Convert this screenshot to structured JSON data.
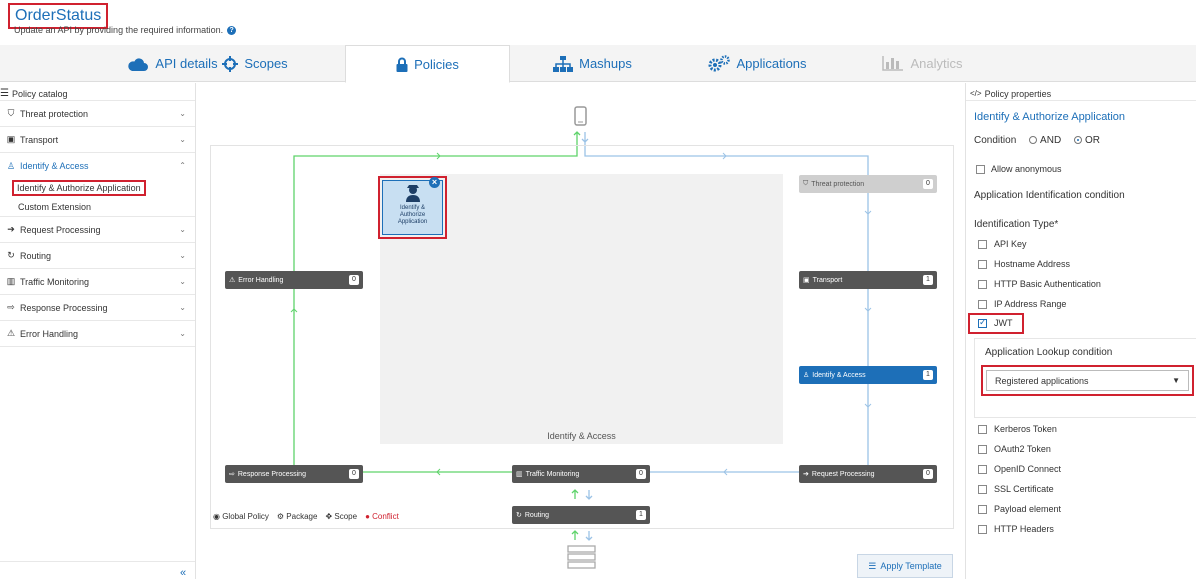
{
  "header": {
    "title": "OrderStatus",
    "subtitle": "Update an API by providing the required information."
  },
  "tabs": [
    {
      "label": "API details",
      "icon": "cloud-icon"
    },
    {
      "label": "Scopes",
      "icon": "crosshair-icon"
    },
    {
      "label": "Policies",
      "icon": "lock-icon"
    },
    {
      "label": "Mashups",
      "icon": "sitemap-icon"
    },
    {
      "label": "Applications",
      "icon": "gears-icon"
    },
    {
      "label": "Analytics",
      "icon": "bar-chart-icon"
    }
  ],
  "catalog": {
    "title": "Policy catalog",
    "items": [
      {
        "label": "Threat protection",
        "icon": "shield-icon"
      },
      {
        "label": "Transport",
        "icon": "bus-icon"
      },
      {
        "label": "Identify & Access",
        "icon": "user-lock-icon"
      },
      {
        "label": "Request Processing",
        "icon": "sign-in-icon"
      },
      {
        "label": "Routing",
        "icon": "refresh-icon"
      },
      {
        "label": "Traffic Monitoring",
        "icon": "bar-chart-icon"
      },
      {
        "label": "Response Processing",
        "icon": "sign-out-icon"
      },
      {
        "label": "Error Handling",
        "icon": "warning-icon"
      }
    ],
    "subitems": [
      "Identify & Authorize Application",
      "Custom Extension"
    ]
  },
  "flow": {
    "threat": {
      "label": "Threat protection",
      "count": "0"
    },
    "transport": {
      "label": "Transport",
      "count": "1"
    },
    "identify": {
      "label": "Identify & Access",
      "count": "1"
    },
    "request": {
      "label": "Request Processing",
      "count": "0"
    },
    "traffic": {
      "label": "Traffic Monitoring",
      "count": "0"
    },
    "routing": {
      "label": "Routing",
      "count": "1"
    },
    "response": {
      "label": "Response Processing",
      "count": "0"
    },
    "error": {
      "label": "Error Handling",
      "count": "0"
    },
    "area_label": "Identify & Access",
    "policy_card": "Identify & Authorize Application"
  },
  "legend": {
    "global": "Global Policy",
    "package": "Package",
    "scope": "Scope",
    "conflict": "Conflict"
  },
  "apply_template": "Apply Template",
  "properties": {
    "title": "Policy properties",
    "policy_name": "Identify & Authorize Application",
    "condition_label": "Condition",
    "and": "AND",
    "or": "OR",
    "allow_anonymous": "Allow anonymous",
    "app_id_condition": "Application Identification condition",
    "id_type_label": "Identification Type*",
    "types_top": [
      "API Key",
      "Hostname Address",
      "HTTP Basic Authentication",
      "IP Address Range",
      "JWT"
    ],
    "lookup_label": "Application Lookup condition",
    "lookup_value": "Registered applications",
    "types_bottom": [
      "Kerberos Token",
      "OAuth2 Token",
      "OpenID Connect",
      "SSL Certificate",
      "Payload element",
      "HTTP Headers"
    ]
  },
  "colors": {
    "accent": "#1d6fb8",
    "highlight": "#d0212f",
    "green": "#5fd36b",
    "flowblue": "#9cc3e6"
  }
}
